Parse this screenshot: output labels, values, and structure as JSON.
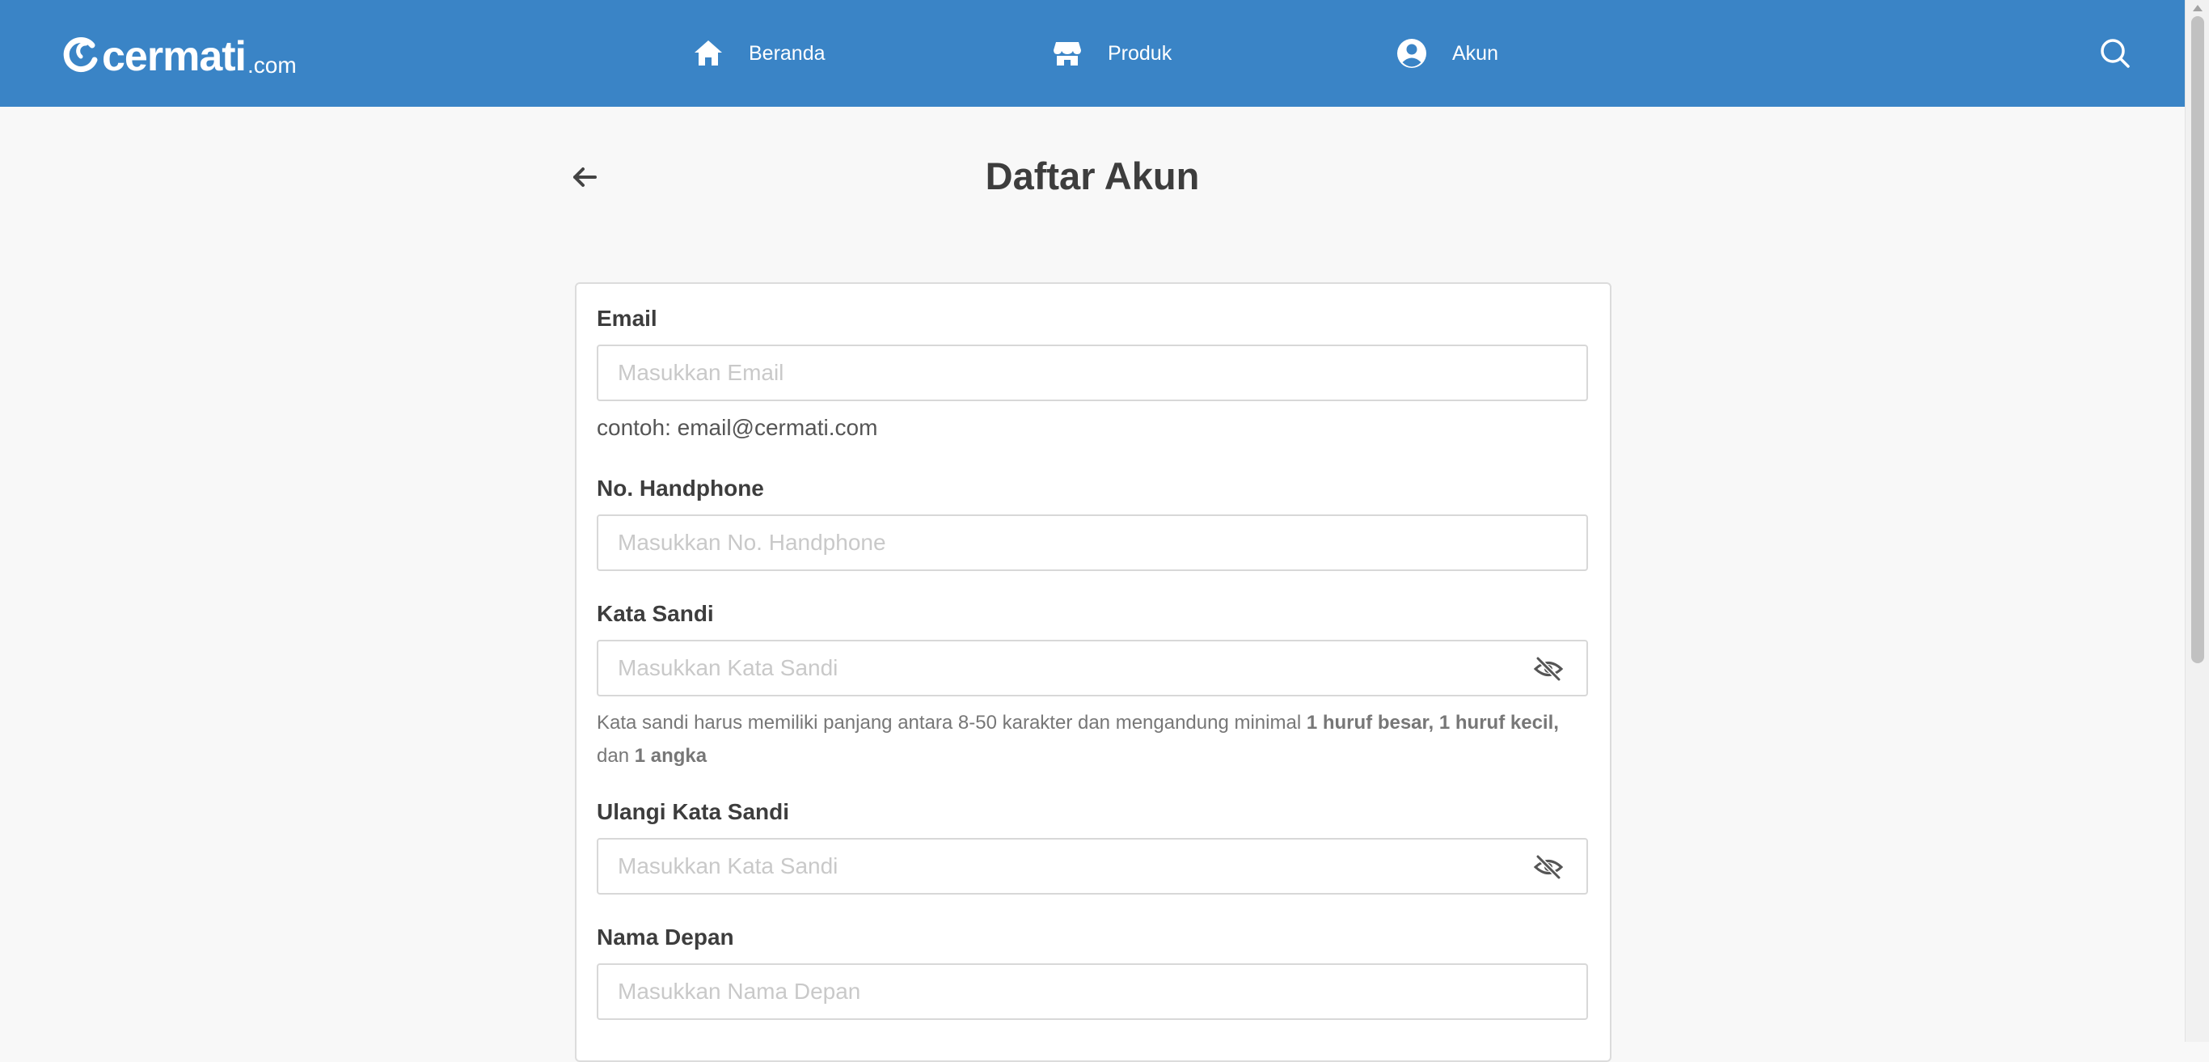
{
  "header": {
    "logo_text": "cermati",
    "logo_suffix": ".com",
    "nav": {
      "home": "Beranda",
      "products": "Produk",
      "account": "Akun"
    },
    "icons": {
      "home": "home-icon",
      "products": "store-icon",
      "account": "user-circle-icon",
      "search": "search-icon"
    },
    "color": "#3a84c6"
  },
  "page": {
    "title": "Daftar Akun",
    "back_icon": "arrow-left-icon"
  },
  "form": {
    "email": {
      "label": "Email",
      "placeholder": "Masukkan Email",
      "value": "",
      "helper": "contoh: email@cermati.com"
    },
    "phone": {
      "label": "No. Handphone",
      "placeholder": "Masukkan No. Handphone",
      "value": ""
    },
    "password": {
      "label": "Kata Sandi",
      "placeholder": "Masukkan Kata Sandi",
      "value": "",
      "hint": {
        "prefix": "Kata sandi harus memiliki panjang antara 8-50 karakter dan mengandung minimal ",
        "bold1": "1 huruf besar, 1 huruf kecil,",
        "middle": " dan ",
        "bold2": "1 angka"
      },
      "toggle_icon": "eye-off-icon"
    },
    "password_confirm": {
      "label": "Ulangi Kata Sandi",
      "placeholder": "Masukkan Kata Sandi",
      "value": "",
      "toggle_icon": "eye-off-icon"
    },
    "first_name": {
      "label": "Nama Depan",
      "placeholder": "Masukkan Nama Depan",
      "value": ""
    }
  }
}
